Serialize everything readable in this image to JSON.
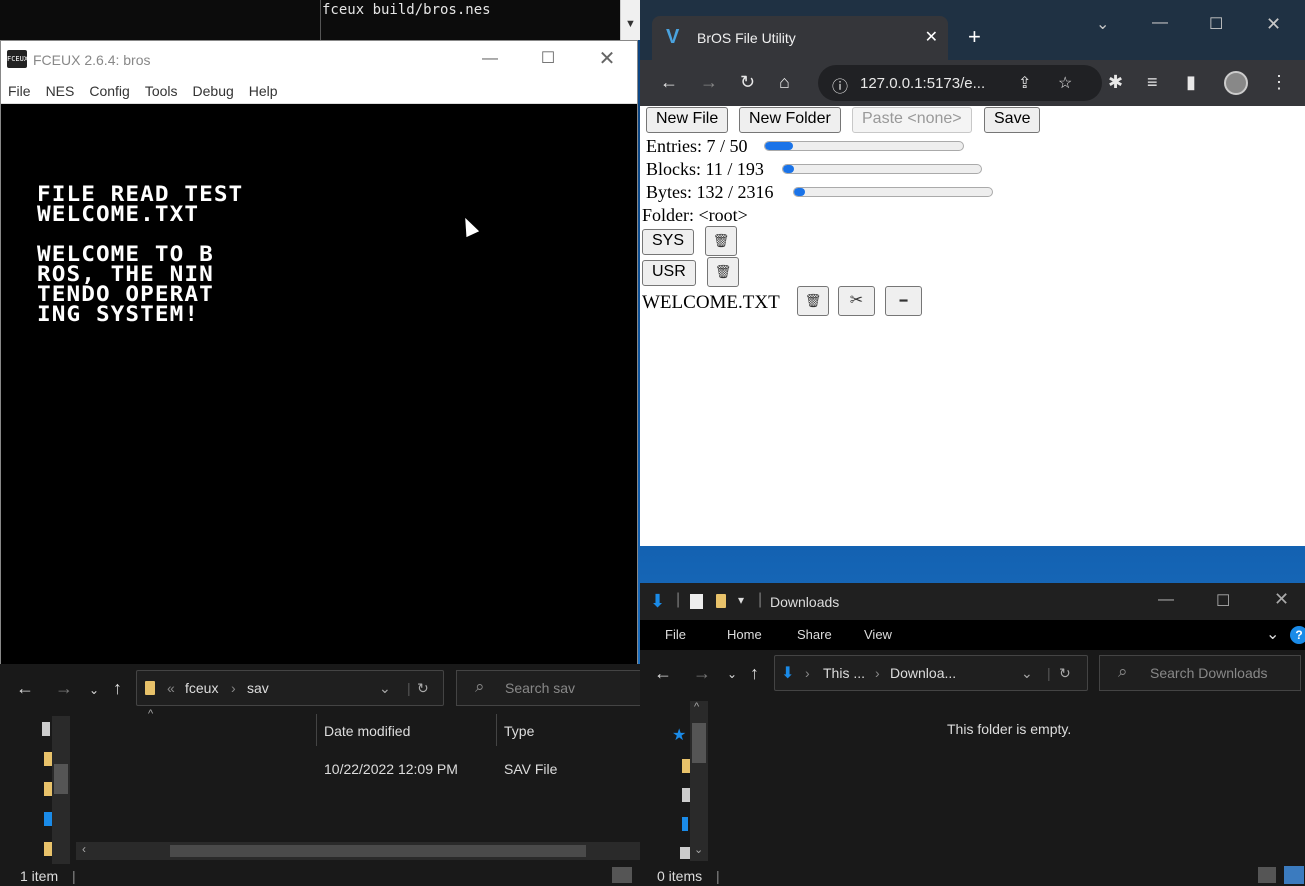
{
  "terminal": {
    "command": "fceux build/bros.nes"
  },
  "fceux": {
    "title": "FCEUX 2.6.4: bros",
    "icon_text": "FCEUX",
    "menu": [
      "File",
      "NES",
      "Config",
      "Tools",
      "Debug",
      "Help"
    ],
    "screen_line1": "FILE READ TEST",
    "screen_line2": "WELCOME.TXT",
    "screen_body": [
      "WELCOME TO B",
      "ROS, THE NIN",
      "TENDO OPERAT",
      "ING SYSTEM!"
    ]
  },
  "explorer_left": {
    "path": [
      "fceux",
      "sav"
    ],
    "search_placeholder": "Search sav",
    "columns": {
      "date": "Date modified",
      "type": "Type"
    },
    "rows": [
      {
        "date": "10/22/2022 12:09 PM",
        "type": "SAV File"
      }
    ],
    "status": "1 item"
  },
  "chrome": {
    "tab_title": "BrOS File Utility",
    "url": "127.0.0.1:5173/e...",
    "page": {
      "buttons": {
        "new_file": "New File",
        "new_folder": "New Folder",
        "paste": "Paste <none>",
        "save": "Save"
      },
      "entries": {
        "label": "Entries: 7 / 50",
        "fraction": 0.14
      },
      "blocks": {
        "label": "Blocks: 11 / 193",
        "fraction": 0.057
      },
      "bytes": {
        "label": "Bytes: 132 / 2316",
        "fraction": 0.057
      },
      "folder": "Folder: <root>",
      "folders": [
        "SYS",
        "USR"
      ],
      "file": "WELCOME.TXT",
      "trash_glyph": "🗑",
      "cut_glyph": "✂",
      "open_glyph": "━"
    }
  },
  "explorer_right": {
    "title": "Downloads",
    "ribbon": [
      "File",
      "Home",
      "Share",
      "View"
    ],
    "path": [
      "This ...",
      "Downloa..."
    ],
    "search_placeholder": "Search Downloads",
    "empty_message": "This folder is empty.",
    "status": "0 items"
  },
  "colors": {
    "accent": "#1a73e8",
    "folder": "#e8c26a",
    "dark_bg": "#191919",
    "chrome_frame": "#35363a"
  }
}
